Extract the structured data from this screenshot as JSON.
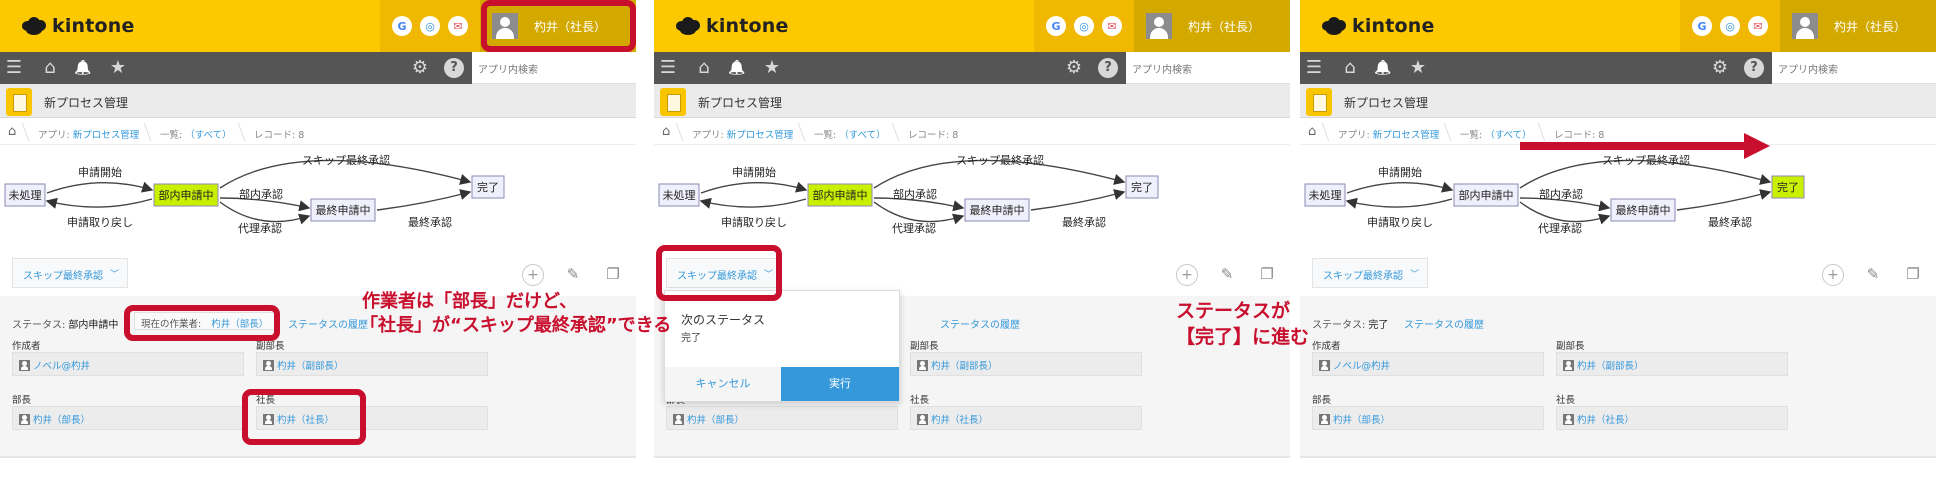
{
  "app": {
    "logo_text": "kintone",
    "user_name": "杓井（社長）",
    "search_placeholder": "アプリ内検索",
    "app_title": "新プロセス管理",
    "icons": [
      "google-icon",
      "garoon-icon",
      "mail-icon",
      "user-avatar-icon",
      "menu-icon",
      "home-icon",
      "bell-icon",
      "star-icon",
      "gear-icon",
      "help-icon"
    ]
  },
  "breadcrumb": {
    "app_prefix": "アプリ:",
    "app_link": "新プロセス管理",
    "list_prefix": "一覧:",
    "list_link": "（すべて）",
    "record_label": "レコード: 8"
  },
  "flow": {
    "nodes": [
      "未処理",
      "部内申請中",
      "最終申請中",
      "完了"
    ],
    "edges": [
      "申請開始",
      "申請取り戻し",
      "部内承認",
      "代理承認",
      "最終承認",
      "スキップ最終承認"
    ]
  },
  "action": {
    "button_label": "スキップ最終承認",
    "chevron": "﹀"
  },
  "record_p1": {
    "status_prefix": "ステータス:",
    "status_value": "部内申請中",
    "worker_prefix": "現在の作業者:",
    "worker_value": "杓井（部長）",
    "history_link": "ステータスの履歴"
  },
  "record_p3": {
    "status_prefix": "ステータス:",
    "status_value": "完了",
    "history_link": "ステータスの履歴"
  },
  "fields": {
    "creator_label": "作成者",
    "creator_value": "ノベル@杓井",
    "vice_label": "副部長",
    "vice_value": "杓井（副部長）",
    "manager_label": "部長",
    "manager_value": "杓井（部長）",
    "president_label": "社長",
    "president_value": "杓井（社長）"
  },
  "dropdown": {
    "header": "次のステータス",
    "value": "完了",
    "cancel_label": "キャンセル",
    "execute_label": "実行"
  },
  "annotations": {
    "p1_line1": "作業者は「部長」だけど、",
    "p1_line2": "「社長」が“スキップ最終承認”できる",
    "p2_line1": "ステータスが",
    "p2_line2": "【完了】に進む"
  },
  "colors": {
    "header_yellow": "#fcc800",
    "nav_gray": "#555555",
    "link_blue": "#3498db",
    "node_active": "#c8f000",
    "node_default": "#f0f0fc",
    "annotation_red": "#c8102e"
  }
}
